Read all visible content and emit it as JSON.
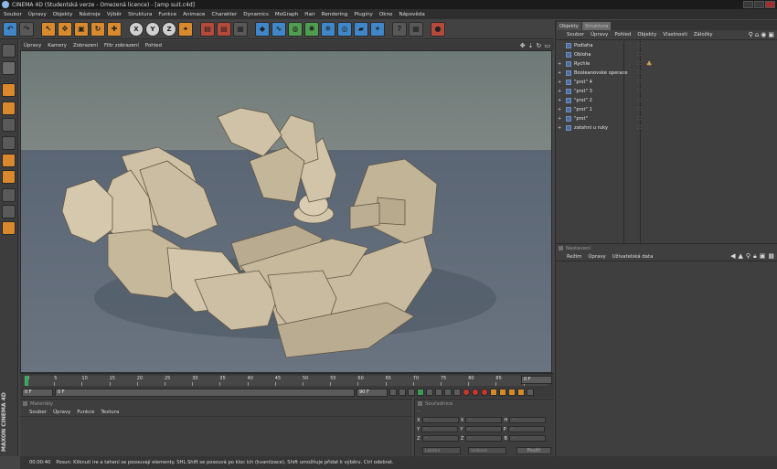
{
  "window": {
    "title": "CINEMA 4D (Studentská verze - Omezená licence) - [amp suit.c4d]"
  },
  "menu": [
    "Soubor",
    "Úpravy",
    "Objekty",
    "Nástroje",
    "Výběr",
    "Struktura",
    "Funkce",
    "Animace",
    "Charakter",
    "Dynamics",
    "MoGraph",
    "Hair",
    "Rendering",
    "Pluginy",
    "Okno",
    "Nápověda"
  ],
  "toolbar": {
    "x_label": "X",
    "y_label": "Y",
    "z_label": "Z"
  },
  "viewport": {
    "menu": [
      "Úpravy",
      "Kamery",
      "Zobrazení",
      "Filtr zobrazení",
      "Pohled"
    ]
  },
  "timeline": {
    "ticks": [
      "0",
      "5",
      "10",
      "15",
      "20",
      "25",
      "30",
      "35",
      "40",
      "45",
      "50",
      "55",
      "60",
      "65",
      "70",
      "75",
      "80",
      "85",
      "90"
    ],
    "end_field": "0 F"
  },
  "playback": {
    "start": "0 F",
    "scrub": "0 F",
    "end": "90 F"
  },
  "materials": {
    "title": "Materiály",
    "menu": [
      "Soubor",
      "Úpravy",
      "Funkce",
      "Textura"
    ]
  },
  "coordinates": {
    "title": "Souřadnice",
    "header": "--",
    "rows": [
      {
        "a": "X",
        "b": "X",
        "c": "H"
      },
      {
        "a": "Y",
        "b": "Y",
        "c": "P"
      },
      {
        "a": "Z",
        "b": "Z",
        "c": "B"
      }
    ],
    "placeholder": "--",
    "mode1": "Lokální",
    "mode2": "Velikost",
    "apply": "Použít"
  },
  "objects": {
    "tabs": [
      "Objekty",
      "Struktura"
    ],
    "menu": [
      "Soubor",
      "Úpravy",
      "Pohled",
      "Objekty",
      "Vlastnosti",
      "Záložky"
    ],
    "items": [
      {
        "label": "Podlaha",
        "expand": "",
        "tag": ""
      },
      {
        "label": "Obloha",
        "expand": "",
        "tag": ""
      },
      {
        "label": "Rychle",
        "expand": "+",
        "tag": "♣"
      },
      {
        "label": "Booleanovské operace",
        "expand": "+",
        "tag": ""
      },
      {
        "label": "\"prst\" 4",
        "expand": "+",
        "tag": ""
      },
      {
        "label": "\"prst\" 3",
        "expand": "+",
        "tag": ""
      },
      {
        "label": "\"prst\" 2",
        "expand": "+",
        "tag": ""
      },
      {
        "label": "\"prst\" 1",
        "expand": "+",
        "tag": ""
      },
      {
        "label": "\"prst\"",
        "expand": "+",
        "tag": ""
      },
      {
        "label": "zatahni u ruky",
        "expand": "+",
        "tag": ""
      }
    ]
  },
  "attributes": {
    "title": "Nastavení",
    "menu": [
      "Režim",
      "Úpravy",
      "Uživatelská data"
    ]
  },
  "status": {
    "time": "00:00:40",
    "text": "Posun: Kliknutí ire a tahení se posouvají elementy. SHL Shift se posouvá po kloc ích (kvantizace). Shift umožňuje přidat k výběru. Ctrl odebrat."
  },
  "brand": {
    "maxon": "MAXON",
    "c4d": "CINEMA 4D"
  }
}
